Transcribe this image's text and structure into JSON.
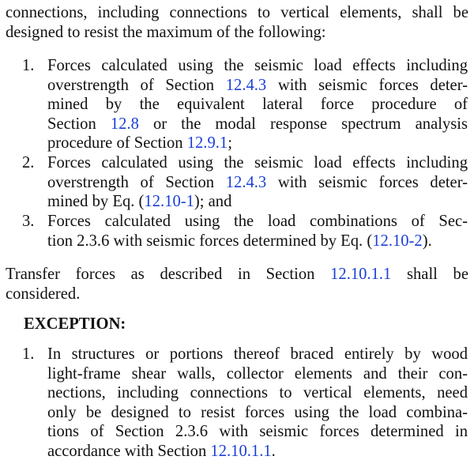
{
  "intro": {
    "line1": "connections, including connections to vertical elements, shall be",
    "line2": "designed to resist the maximum of the following:"
  },
  "list1": [
    {
      "number": "1.",
      "l1": "Forces calculated using the seismic load effects including",
      "l2a": "overstrength of Section ",
      "l2link": "12.4.3",
      "l2b": " with seismic forces deter-",
      "l3": "mined by the equivalent lateral force procedure of",
      "l4a": "Section ",
      "l4link": "12.8",
      "l4b": " or the modal response spectrum analysis",
      "l5a": "procedure of Section ",
      "l5link": "12.9.1",
      "l5b": ";"
    },
    {
      "number": "2.",
      "l1": "Forces calculated using the seismic load effects including",
      "l2a": "overstrength of Section ",
      "l2link": "12.4.3",
      "l2b": " with seismic forces deter-",
      "l3a": "mined by Eq. (",
      "l3link": "12.10-1",
      "l3b": "); and"
    },
    {
      "number": "3.",
      "l1": "Forces calculated using the load combinations of Sec-",
      "l2a": "tion 2.3.6 with seismic forces determined by Eq. (",
      "l2link": "12.10-2",
      "l2b": ")."
    }
  ],
  "transfer": {
    "l1a": "Transfer forces as described in Section ",
    "l1link": "12.10.1.1",
    "l1b": " shall be",
    "l2": "considered."
  },
  "exception": {
    "heading": "EXCEPTION:",
    "number": "1.",
    "l1": "In structures or portions thereof braced entirely by wood",
    "l2": "light-frame shear walls, collector elements and their con-",
    "l3": "nections, including connections to vertical elements, need",
    "l4": "only be designed to resist forces using the load combina-",
    "l5": "tions of Section 2.3.6 with seismic forces determined in",
    "l6a": "accordance with Section ",
    "l6link": "12.10.1.1",
    "l6b": "."
  },
  "colors": {
    "text": "#111111",
    "link": "#1a3fd6"
  }
}
